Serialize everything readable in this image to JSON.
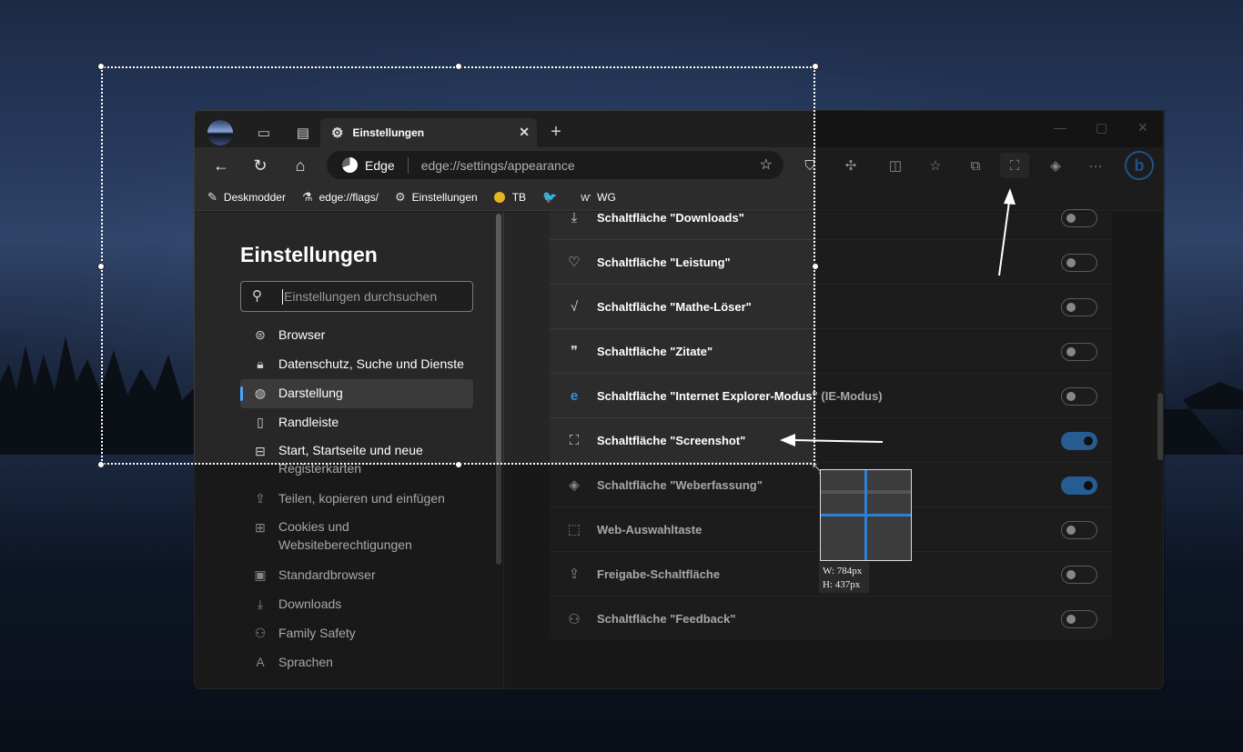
{
  "browser": {
    "tab": {
      "title": "Einstellungen",
      "icon": "gear-icon"
    },
    "address": {
      "site_label": "Edge",
      "url": "edge://settings/appearance"
    },
    "bookmarks": [
      {
        "label": "Deskmodder",
        "icon": "pen-icon"
      },
      {
        "label": "edge://flags/",
        "icon": "flask-icon"
      },
      {
        "label": "Einstellungen",
        "icon": "gear-icon"
      },
      {
        "label": "TB",
        "icon": "coin-icon"
      },
      {
        "label": "",
        "icon": "twitter-icon"
      },
      {
        "label": "WG",
        "icon": "wg-icon"
      }
    ]
  },
  "sidebar": {
    "title": "Einstellungen",
    "search_placeholder": "Einstellungen durchsuchen",
    "items": [
      {
        "label": "Browser",
        "icon": "browser-icon"
      },
      {
        "label": "Datenschutz, Suche und Dienste",
        "icon": "lock-icon"
      },
      {
        "label": "Darstellung",
        "icon": "palette-icon",
        "selected": true
      },
      {
        "label": "Randleiste",
        "icon": "sidebar-icon"
      },
      {
        "label": "Start, Startseite und neue Registerkarten",
        "icon": "home-tabs-icon"
      },
      {
        "label": "Teilen, kopieren und einfügen",
        "icon": "share-icon"
      },
      {
        "label": "Cookies und Websiteberechtigungen",
        "icon": "cookie-icon"
      },
      {
        "label": "Standardbrowser",
        "icon": "default-browser-icon"
      },
      {
        "label": "Downloads",
        "icon": "download-icon"
      },
      {
        "label": "Family Safety",
        "icon": "family-icon"
      },
      {
        "label": "Sprachen",
        "icon": "language-icon"
      }
    ]
  },
  "settings_rows": [
    {
      "label": "Schaltfläche \"Downloads\"",
      "icon": "download-icon",
      "on": false
    },
    {
      "label": "Schaltfläche \"Leistung\"",
      "icon": "heartbeat-icon",
      "on": false
    },
    {
      "label": "Schaltfläche \"Mathe-Löser\"",
      "icon": "math-icon",
      "on": false
    },
    {
      "label": "Schaltfläche \"Zitate\"",
      "icon": "quote-icon",
      "on": false
    },
    {
      "label": "Schaltfläche \"Internet Explorer-Modus\" (IE-Modus)",
      "icon": "ie-icon",
      "on": false
    },
    {
      "label": "Schaltfläche \"Screenshot\"",
      "icon": "screenshot-icon",
      "on": true
    },
    {
      "label": "Schaltfläche \"Weberfassung\"",
      "icon": "web-capture-icon",
      "on": true
    },
    {
      "label": "Web-Auswahltaste",
      "icon": "web-select-icon",
      "on": false
    },
    {
      "label": "Freigabe-Schaltfläche",
      "icon": "share-icon",
      "on": false
    },
    {
      "label": "Schaltfläche \"Feedback\"",
      "icon": "feedback-icon",
      "on": false
    }
  ],
  "capture": {
    "width_label": "W: 784px",
    "height_label": "H: 437px"
  }
}
